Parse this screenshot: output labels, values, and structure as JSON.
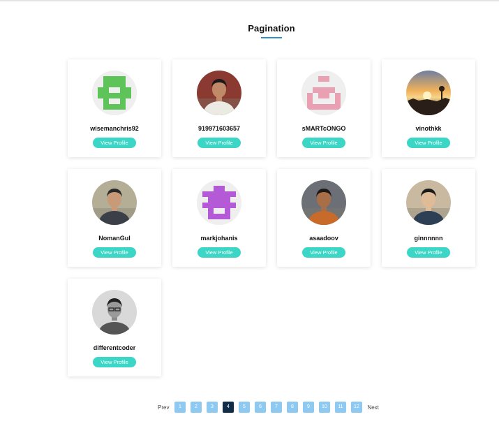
{
  "page": {
    "title": "Pagination"
  },
  "users": [
    {
      "username": "wisemanchris92",
      "button": "View Profile",
      "avatar": "identicon-green-avatar",
      "color": "#5ec45a"
    },
    {
      "username": "919971603657",
      "button": "View Profile",
      "avatar": "photo-man-white-shirt",
      "color": "#ecebe3"
    },
    {
      "username": "sMARTcONGO",
      "button": "View Profile",
      "avatar": "identicon-pink-avatar",
      "color": "#e8a0b2"
    },
    {
      "username": "vinothkk",
      "button": "View Profile",
      "avatar": "photo-sunset",
      "color": "#f3a23a"
    },
    {
      "username": "NomanGul",
      "button": "View Profile",
      "avatar": "photo-man-glasses",
      "color": "#9a8f6c"
    },
    {
      "username": "markjohanis",
      "button": "View Profile",
      "avatar": "identicon-purple-avatar",
      "color": "#b45ad6"
    },
    {
      "username": "asaadoov",
      "button": "View Profile",
      "avatar": "photo-man-orange-shirt",
      "color": "#c86a2a"
    },
    {
      "username": "ginnnnnn",
      "button": "View Profile",
      "avatar": "photo-man-smiling-glasses",
      "color": "#d8c6a8"
    },
    {
      "username": "differentcoder",
      "button": "View Profile",
      "avatar": "photo-man-grayscale",
      "color": "#8a8a8a"
    }
  ],
  "pagination": {
    "prev_label": "Prev",
    "next_label": "Next",
    "pages": [
      "1",
      "2",
      "3",
      "4",
      "5",
      "6",
      "7",
      "8",
      "9",
      "10",
      "11",
      "12"
    ],
    "current": "4"
  }
}
